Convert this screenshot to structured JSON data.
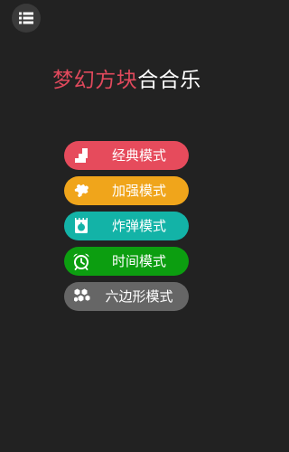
{
  "header": {
    "menu_icon": "list-icon"
  },
  "title": {
    "main": "梦幻方块",
    "sub": "合合乐"
  },
  "modes": [
    {
      "label": "经典模式",
      "color": "#e64b5c",
      "icon": "blocks-icon"
    },
    {
      "label": "加强模式",
      "color": "#f0a51b",
      "icon": "puzzle-icon"
    },
    {
      "label": "炸弹模式",
      "color": "#13b3a7",
      "icon": "bomb-icon"
    },
    {
      "label": "时间模式",
      "color": "#0c9e10",
      "icon": "alarm-clock-icon"
    },
    {
      "label": "六边形模式",
      "color": "#666666",
      "icon": "hexagon-icon"
    }
  ]
}
